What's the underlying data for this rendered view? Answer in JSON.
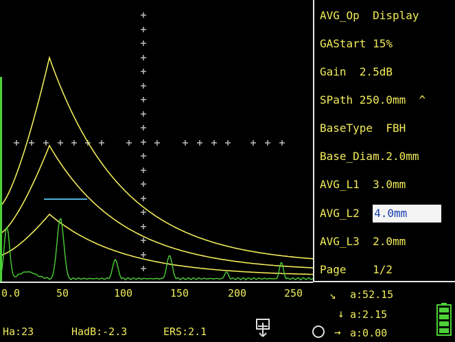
{
  "menu": {
    "items": [
      {
        "label": "AVG_Op  Display"
      },
      {
        "label": "GAStart 15%"
      },
      {
        "label": "Gain  2.5dB"
      },
      {
        "label": "SPath 250.0mm  ^"
      },
      {
        "label": "BaseType  FBH"
      },
      {
        "label": "Base_Diam.2.0mm"
      },
      {
        "label": "AVG_L1  3.0mm"
      },
      {
        "label": "AVG_L2  ",
        "value": "4.0mm",
        "selected": true
      },
      {
        "label": "AVG_L3  2.0mm"
      },
      {
        "label": "Page    1/2"
      }
    ]
  },
  "axis": {
    "ticks": [
      "0.0",
      "50",
      "100",
      "150",
      "200",
      "250"
    ]
  },
  "status": {
    "ha": "Ha:23",
    "hadb": "HadB:-2.3",
    "ers": "ERS:2.1"
  },
  "readouts": {
    "sound_path": "a:52.15",
    "depth": "a:2.15",
    "surface": "a:0.00"
  },
  "icons": {
    "sound_path_arrow": "diagonal-arrow-icon",
    "depth_arrow": "down-arrow-icon",
    "surface_arrow": "right-arrow-icon",
    "freeze": "freeze-icon",
    "battery": "battery-icon"
  },
  "colors": {
    "background": "#000000",
    "text": "#f2ec5a",
    "curve": "#f2ec5a",
    "echo": "#4cd137",
    "gate": "#4fb3d9",
    "grid": "#bdbdbd",
    "highlight_bg": "#f4f4f4",
    "highlight_text": "#1a3fb0"
  }
}
